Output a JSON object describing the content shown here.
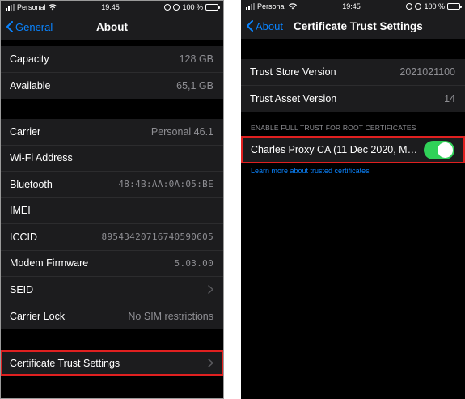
{
  "left": {
    "status": {
      "carrier": "Personal",
      "time": "19:45",
      "battery": "100 %"
    },
    "nav": {
      "back_label": "General",
      "title": "About"
    },
    "group1": [
      {
        "label": "Capacity",
        "value": "128 GB"
      },
      {
        "label": "Available",
        "value": "65,1 GB"
      }
    ],
    "group2": [
      {
        "label": "Carrier",
        "value": "Personal 46.1"
      },
      {
        "label": "Wi-Fi Address",
        "value": ""
      },
      {
        "label": "Bluetooth",
        "value": "48:4B:AA:0A:05:BE"
      },
      {
        "label": "IMEI",
        "value": ""
      },
      {
        "label": "ICCID",
        "value": "89543420716740590605"
      },
      {
        "label": "Modem Firmware",
        "value": "5.03.00"
      },
      {
        "label": "SEID",
        "value": ""
      },
      {
        "label": "Carrier Lock",
        "value": "No SIM restrictions"
      }
    ],
    "cert_trust_label": "Certificate Trust Settings"
  },
  "right": {
    "status": {
      "carrier": "Personal",
      "time": "19:45",
      "battery": "100 %"
    },
    "nav": {
      "back_label": "About",
      "title": "Certificate Trust Settings"
    },
    "versions": [
      {
        "label": "Trust Store Version",
        "value": "2021021100"
      },
      {
        "label": "Trust Asset Version",
        "value": "14"
      }
    ],
    "section_header": "ENABLE FULL TRUST FOR ROOT CERTIFICATES",
    "cert": {
      "label": "Charles Proxy CA (11 Dec 2020, Ma...",
      "enabled": true
    },
    "learn_more": "Learn more about trusted certificates"
  },
  "colors": {
    "accent": "#0a84ff",
    "toggle_on": "#30d158",
    "highlight": "#e02020",
    "cell_bg": "#1c1c1e"
  },
  "icons": [
    "signal-icon",
    "wifi-icon",
    "orientation-lock-icon",
    "alarm-icon",
    "battery-icon",
    "chevron-left-icon",
    "chevron-right-icon"
  ]
}
